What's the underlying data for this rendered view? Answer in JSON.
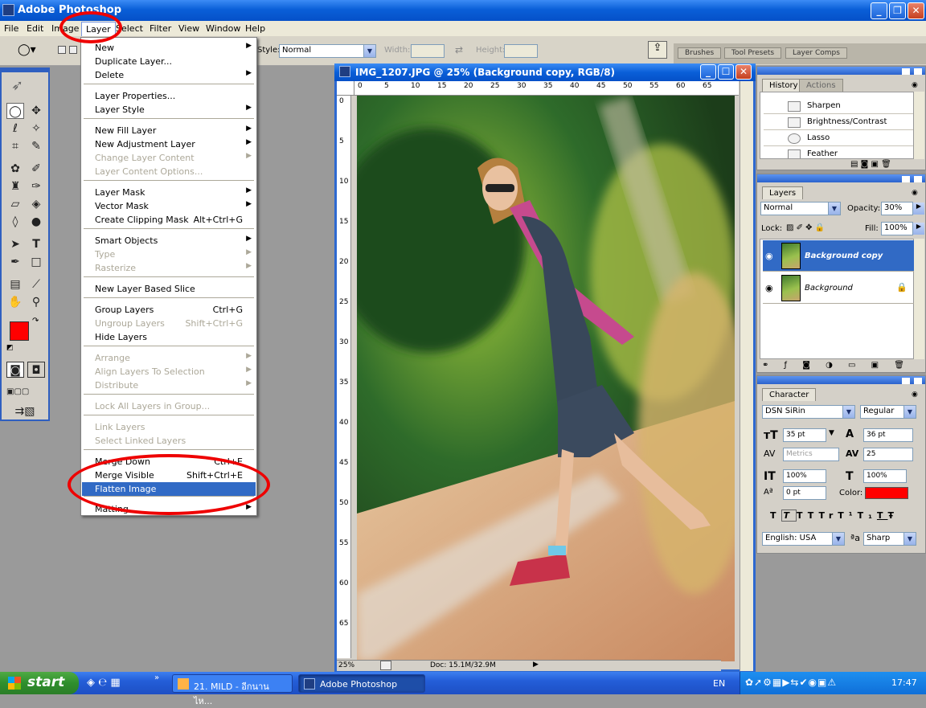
{
  "app": {
    "title": "Adobe Photoshop"
  },
  "menubar": [
    "File",
    "Edit",
    "Image",
    "Layer",
    "Select",
    "Filter",
    "View",
    "Window",
    "Help"
  ],
  "options": {
    "style_label": "Style:",
    "style_value": "Normal",
    "width_label": "Width:",
    "height_label": "Height:"
  },
  "palette_tabs": [
    "Brushes",
    "Tool Presets",
    "Layer Comps"
  ],
  "layer_menu": [
    {
      "label": "New",
      "arrow": true
    },
    {
      "label": "Duplicate Layer..."
    },
    {
      "label": "Delete",
      "arrow": true
    },
    {
      "label": "Layer Properties..."
    },
    {
      "label": "Layer Style",
      "arrow": true
    },
    {
      "label": "New Fill Layer",
      "arrow": true
    },
    {
      "label": "New Adjustment Layer",
      "arrow": true
    },
    {
      "label": "Change Layer Content",
      "arrow": true,
      "disabled": true
    },
    {
      "label": "Layer Content Options...",
      "disabled": true
    },
    {
      "label": "Layer Mask",
      "arrow": true
    },
    {
      "label": "Vector Mask",
      "arrow": true
    },
    {
      "label": "Create Clipping Mask",
      "shortcut": "Alt+Ctrl+G"
    },
    {
      "label": "Smart Objects",
      "arrow": true
    },
    {
      "label": "Type",
      "arrow": true,
      "disabled": true
    },
    {
      "label": "Rasterize",
      "arrow": true,
      "disabled": true
    },
    {
      "label": "New Layer Based Slice"
    },
    {
      "label": "Group Layers",
      "shortcut": "Ctrl+G"
    },
    {
      "label": "Ungroup Layers",
      "shortcut": "Shift+Ctrl+G",
      "disabled": true
    },
    {
      "label": "Hide Layers"
    },
    {
      "label": "Arrange",
      "arrow": true,
      "disabled": true
    },
    {
      "label": "Align Layers To Selection",
      "arrow": true,
      "disabled": true
    },
    {
      "label": "Distribute",
      "arrow": true,
      "disabled": true
    },
    {
      "label": "Lock All Layers in Group...",
      "disabled": true
    },
    {
      "label": "Link Layers",
      "disabled": true
    },
    {
      "label": "Select Linked Layers",
      "disabled": true
    },
    {
      "label": "Merge Down",
      "shortcut": "Ctrl+E"
    },
    {
      "label": "Merge Visible",
      "shortcut": "Shift+Ctrl+E"
    },
    {
      "label": "Flatten Image",
      "highlighted": true
    },
    {
      "label": "Matting",
      "arrow": true
    }
  ],
  "document": {
    "title": "IMG_1207.JPG @ 25% (Background copy, RGB/8)",
    "ruler_h": [
      "0",
      "5",
      "10",
      "15",
      "20",
      "25",
      "30",
      "35",
      "40",
      "45",
      "50",
      "55",
      "60",
      "65"
    ],
    "ruler_v": [
      "0",
      "5",
      "10",
      "15",
      "20",
      "25",
      "30",
      "35",
      "40",
      "45",
      "50",
      "55",
      "60",
      "65"
    ],
    "zoom": "25%",
    "doc_info": "Doc: 15.1M/32.9M"
  },
  "history": {
    "tabs": [
      "History",
      "Actions"
    ],
    "items": [
      "Sharpen",
      "Brightness/Contrast",
      "Lasso",
      "Feather"
    ]
  },
  "layers": {
    "tab": "Layers",
    "blend_mode": "Normal",
    "opacity_label": "Opacity:",
    "opacity": "30%",
    "lock_label": "Lock:",
    "fill_label": "Fill:",
    "fill": "100%",
    "items": [
      {
        "name": "Background copy",
        "selected": true
      },
      {
        "name": "Background",
        "selected": false
      }
    ]
  },
  "character": {
    "tab": "Character",
    "font": "DSN SiRin",
    "style": "Regular",
    "size": "35 pt",
    "leading": "36 pt",
    "kerning": "Metrics",
    "tracking": "25",
    "vscale": "100%",
    "hscale": "100%",
    "baseline": "0 pt",
    "color_label": "Color:",
    "text_color": "#ff0000",
    "language": "English: USA",
    "aa_label": "a",
    "antialias": "Sharp",
    "styles": [
      "T",
      "T",
      "TT",
      "Tr",
      "T¹",
      "T₁",
      "T",
      "Ŧ"
    ]
  },
  "taskbar": {
    "start": "start",
    "tasks": [
      "21. MILD - อีกนานไห...",
      "Adobe Photoshop"
    ],
    "lang": "EN",
    "clock": "17:47"
  },
  "colors": {
    "foreground": "#ff0000",
    "background": "#a8e0ff"
  }
}
